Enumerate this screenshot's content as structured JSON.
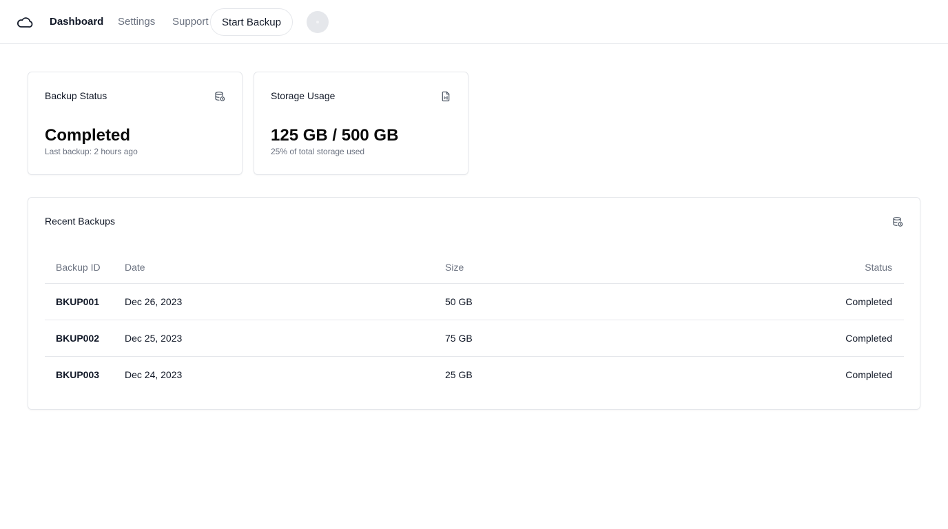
{
  "nav": {
    "logo_icon": "cloud-icon",
    "links": [
      "Dashboard",
      "Settings",
      "Support"
    ],
    "start_backup_label": "Start Backup",
    "avatar_icon": "user-avatar"
  },
  "cards": {
    "backup_status": {
      "title": "Backup Status",
      "icon": "database-backup-icon",
      "value": "Completed",
      "subtitle": "Last backup: 2 hours ago"
    },
    "storage_usage": {
      "title": "Storage Usage",
      "icon": "file-audio-icon",
      "value": "125 GB / 500 GB",
      "subtitle": "25% of total storage used"
    }
  },
  "recent_backups": {
    "title": "Recent Backups",
    "icon": "database-backup-icon",
    "columns": [
      "Backup ID",
      "Date",
      "Size",
      "Status"
    ],
    "rows": [
      {
        "id": "BKUP001",
        "date": "Dec 26, 2023",
        "size": "50 GB",
        "status": "Completed"
      },
      {
        "id": "BKUP002",
        "date": "Dec 25, 2023",
        "size": "75 GB",
        "status": "Completed"
      },
      {
        "id": "BKUP003",
        "date": "Dec 24, 2023",
        "size": "25 GB",
        "status": "Completed"
      }
    ]
  },
  "colors": {
    "border": "#e5e7eb",
    "muted_text": "#6b7280",
    "text": "#111827"
  }
}
